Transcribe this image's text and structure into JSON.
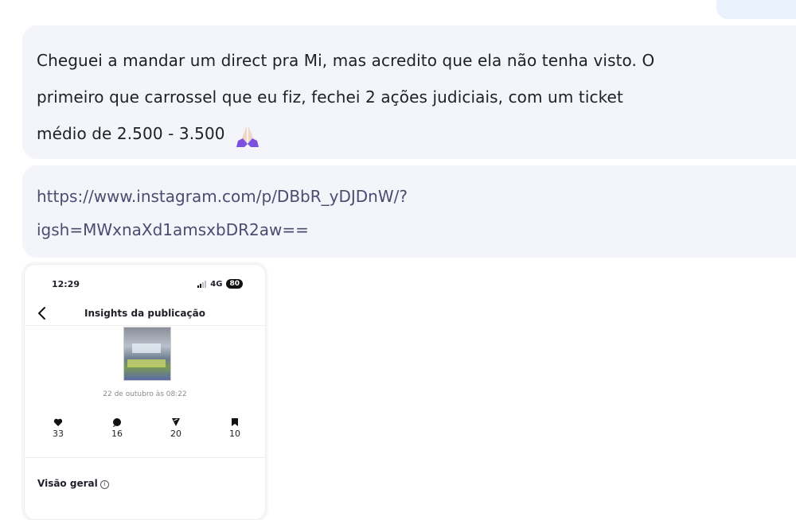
{
  "chat": {
    "message": "Cheguei a mandar um direct pra Mi, mas acredito que ela não tenha visto. O\nprimeiro que carrossel que eu fiz, fechei 2 ações judiciais, com um ticket\nmédio de 2.500 - 3.500",
    "message_emoji": "praying-hands-icon",
    "link": "https://www.instagram.com/p/DBbR_yDJDnW/?\nigsh=MWxnaXd1amsxbDR2aw=="
  },
  "screenshot": {
    "status_time": "12:29",
    "network": "4G",
    "battery": "80",
    "title": "Insights da publicação",
    "date": "22 de outubro às 08:22",
    "metrics": [
      {
        "icon": "heart-icon",
        "value": "33"
      },
      {
        "icon": "comment-icon",
        "value": "16"
      },
      {
        "icon": "share-icon",
        "value": "20"
      },
      {
        "icon": "bookmark-icon",
        "value": "10"
      }
    ],
    "overview_title": "Visão geral"
  },
  "colors": {
    "bubble": "#f4f5fa",
    "link": "#4b4c70",
    "emoji_skin": "#f2d6c4",
    "emoji_sleeve": "#7b4fe0"
  }
}
